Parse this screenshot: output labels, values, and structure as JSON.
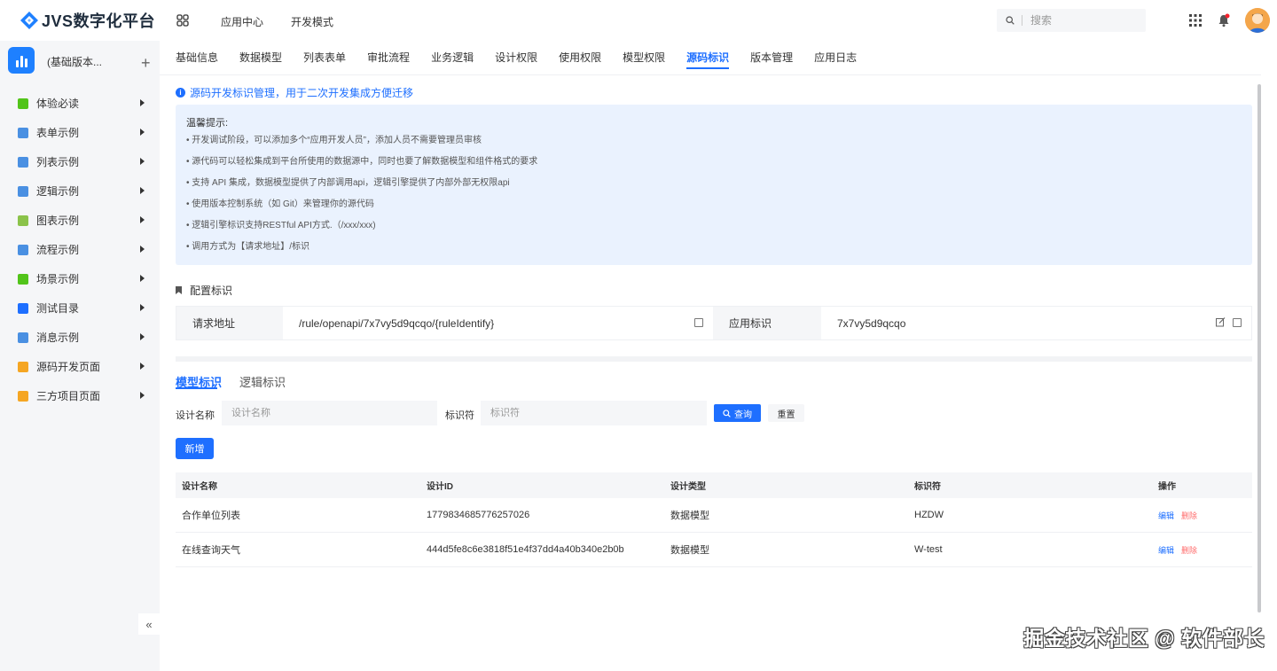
{
  "header": {
    "brand": "JVS数字化平台",
    "nav": [
      "应用中心",
      "开发模式"
    ],
    "search_placeholder": "搜索"
  },
  "sidebar": {
    "app_name": "(基础版本...",
    "add_symbol": "+",
    "collapse_symbol": "«",
    "items": [
      {
        "label": "体验必读",
        "color": "#52c41a"
      },
      {
        "label": "表单示例",
        "color": "#4a90e2"
      },
      {
        "label": "列表示例",
        "color": "#4a90e2"
      },
      {
        "label": "逻辑示例",
        "color": "#4a90e2"
      },
      {
        "label": "图表示例",
        "color": "#8bc34a"
      },
      {
        "label": "流程示例",
        "color": "#4a90e2"
      },
      {
        "label": "场景示例",
        "color": "#52c41a"
      },
      {
        "label": "测试目录",
        "color": "#1e6fff"
      },
      {
        "label": "消息示例",
        "color": "#4a90e2"
      },
      {
        "label": "源码开发页面",
        "color": "#f5a623"
      },
      {
        "label": "三方项目页面",
        "color": "#f5a623"
      }
    ]
  },
  "tabs": [
    "基础信息",
    "数据模型",
    "列表表单",
    "审批流程",
    "业务逻辑",
    "设计权限",
    "使用权限",
    "模型权限",
    "源码标识",
    "版本管理",
    "应用日志"
  ],
  "active_tab": "源码标识",
  "info": {
    "icon": "i",
    "title": "源码开发标识管理，用于二次开发集成方便迁移",
    "tips_title": "温馨提示:",
    "tips": [
      "• 开发调试阶段，可以添加多个“应用开发人员”，添加人员不需要管理员审核",
      "• 源代码可以轻松集成到平台所使用的数据源中，同时也要了解数据模型和组件格式的要求",
      "• 支持 API 集成，数据模型提供了内部调用api，逻辑引擎提供了内部外部无权限api",
      "• 使用版本控制系统（如 Git）来管理你的源代码",
      "• 逻辑引擎标识支持RESTful API方式.（/xxx/xxx)",
      "• 调用方式为【请求地址】/标识"
    ]
  },
  "config": {
    "title": "配置标识",
    "request_label": "请求地址",
    "request_value": "/rule/openapi/7x7vy5d9qcqo/{ruleIdentify}",
    "app_id_label": "应用标识",
    "app_id_value": "7x7vy5d9qcqo"
  },
  "subtabs": [
    "模型标识",
    "逻辑标识"
  ],
  "filter": {
    "name_label": "设计名称",
    "name_placeholder": "设计名称",
    "id_label": "标识符",
    "id_placeholder": "标识符",
    "query": "查询",
    "reset": "重置",
    "new": "新增"
  },
  "table": {
    "headers": [
      "设计名称",
      "设计ID",
      "设计类型",
      "标识符",
      "操作"
    ],
    "rows": [
      {
        "name": "合作单位列表",
        "id": "1779834685776257026",
        "type": "数据模型",
        "code": "HZDW",
        "edit": "编辑",
        "del": "删除"
      },
      {
        "name": "在线查询天气",
        "id": "444d5fe8c6e3818f51e4f37dd4a40b340e2b0b",
        "type": "数据模型",
        "code": "W-test",
        "edit": "编辑",
        "del": "删除"
      }
    ]
  },
  "watermark": "掘金技术社区 @ 软件部长"
}
